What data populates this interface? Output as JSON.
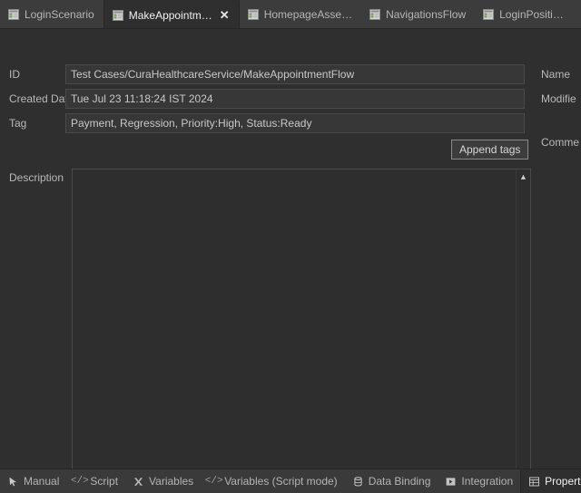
{
  "window": {
    "theme_bg": "#2f2f2f",
    "accent": "#6f9d4a"
  },
  "top_tabs": [
    {
      "label": "LoginScenario",
      "icon": "test-case-grid-icon",
      "active": false,
      "closable": false
    },
    {
      "label": "MakeAppointm…",
      "icon": "test-case-grid-icon",
      "active": true,
      "closable": true,
      "close_label": "✕"
    },
    {
      "label": "HomepageAsse…",
      "icon": "test-case-grid-icon",
      "active": false,
      "closable": false
    },
    {
      "label": "NavigationsFlow",
      "icon": "test-case-grid-icon",
      "active": false,
      "closable": false
    },
    {
      "label": "LoginPositi…",
      "icon": "test-case-grid-icon",
      "active": false,
      "closable": false
    }
  ],
  "form": {
    "id": {
      "label": "ID",
      "value": "Test Cases/CuraHealthcareService/MakeAppointmentFlow",
      "placeholder": ""
    },
    "created_date": {
      "label": "Created Dat",
      "value": "Tue Jul 23 11:18:24 IST 2024",
      "placeholder": ""
    },
    "tag": {
      "label": "Tag",
      "value": "Payment, Regression, Priority:High, Status:Ready",
      "placeholder": ""
    },
    "description": {
      "label": "Description",
      "value": "",
      "placeholder": ""
    },
    "right_labels": {
      "name": "Name",
      "modified": "Modifie",
      "comment": "Comme"
    },
    "append_tags_button": "Append tags"
  },
  "scrollbar": {
    "up_arrow": "▲",
    "down_arrow": "▼"
  },
  "bottom_tabs": [
    {
      "label": "Manual",
      "icon": "cursor-arrow-icon",
      "glyph": "↖",
      "active": false
    },
    {
      "label": "Script",
      "icon": "code-angle-brackets-icon",
      "glyph": "</>",
      "active": false
    },
    {
      "label": "Variables",
      "icon": "variables-x-icon",
      "glyph": "✗",
      "active": false
    },
    {
      "label": "Variables (Script mode)",
      "icon": "code-angle-brackets-icon",
      "glyph": "</>",
      "active": false
    },
    {
      "label": "Data Binding",
      "icon": "database-cylinder-icon",
      "glyph": "⌸",
      "active": false
    },
    {
      "label": "Integration",
      "icon": "integration-play-icon",
      "glyph": "▶",
      "active": false
    },
    {
      "label": "Properties",
      "icon": "properties-grid-icon",
      "glyph": "⌸",
      "active": true
    }
  ]
}
